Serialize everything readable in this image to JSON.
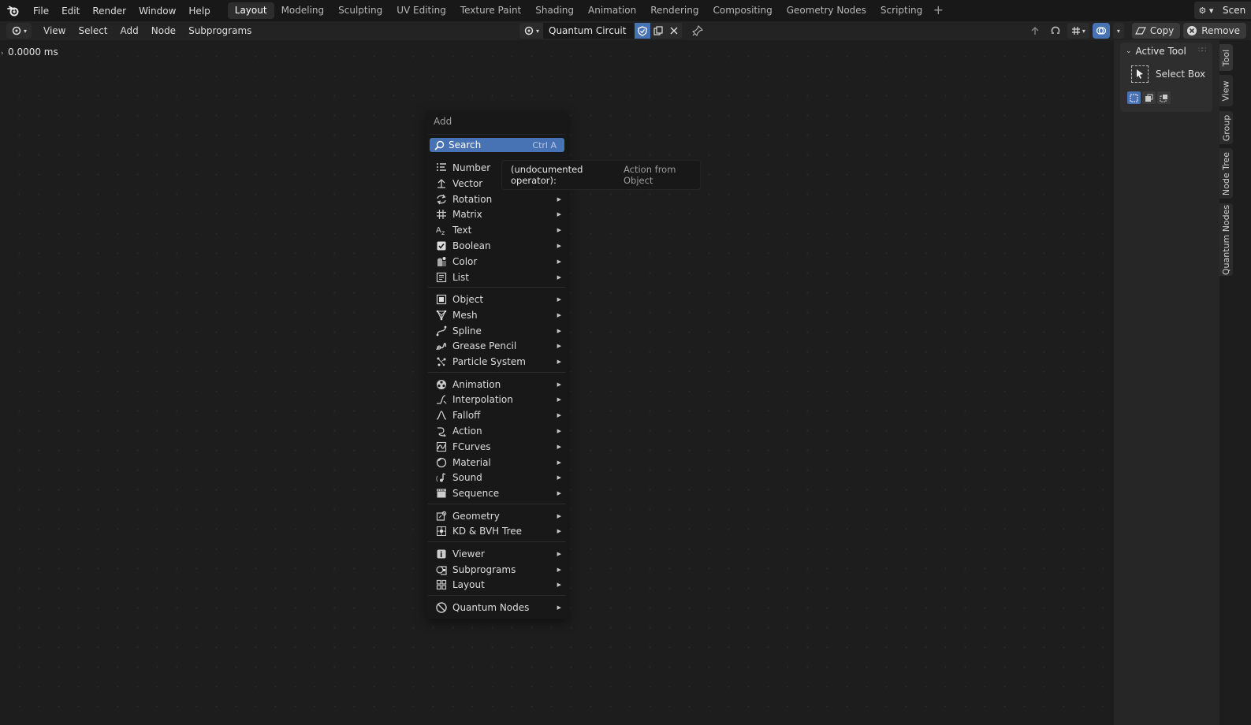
{
  "topbar": {
    "menus": [
      "File",
      "Edit",
      "Render",
      "Window",
      "Help"
    ],
    "workspaces": [
      "Layout",
      "Modeling",
      "Sculpting",
      "UV Editing",
      "Texture Paint",
      "Shading",
      "Animation",
      "Rendering",
      "Compositing",
      "Geometry Nodes",
      "Scripting"
    ],
    "active_workspace": "Layout",
    "add_workspace": "+",
    "scene_label": "Scen"
  },
  "header": {
    "menus": [
      "View",
      "Select",
      "Add",
      "Node",
      "Subprograms"
    ],
    "node_tree_name": "Quantum Circuit",
    "copy_label": "Copy",
    "remove_label": "Remove"
  },
  "canvas": {
    "timing": "0.0000 ms"
  },
  "sidebar": {
    "panel_title": "Active Tool",
    "tool_name": "Select Box",
    "tabs": [
      "Tool",
      "View",
      "Group",
      "Node Tree",
      "Quantum Nodes"
    ]
  },
  "add_menu": {
    "title": "Add",
    "search_label": "Search",
    "search_shortcut": "Ctrl A",
    "groups": [
      [
        {
          "label": "Number",
          "icon": "number-icon",
          "submenu": false
        },
        {
          "label": "Vector",
          "icon": "vector-icon",
          "submenu": false
        },
        {
          "label": "Rotation",
          "icon": "rotation-icon",
          "submenu": true
        },
        {
          "label": "Matrix",
          "icon": "matrix-icon",
          "submenu": true
        },
        {
          "label": "Text",
          "icon": "text-icon",
          "submenu": true
        },
        {
          "label": "Boolean",
          "icon": "checkbox-icon",
          "submenu": true
        },
        {
          "label": "Color",
          "icon": "color-icon",
          "submenu": true
        },
        {
          "label": "List",
          "icon": "list-icon",
          "submenu": true
        }
      ],
      [
        {
          "label": "Object",
          "icon": "object-icon",
          "submenu": true
        },
        {
          "label": "Mesh",
          "icon": "mesh-icon",
          "submenu": true
        },
        {
          "label": "Spline",
          "icon": "spline-icon",
          "submenu": true
        },
        {
          "label": "Grease Pencil",
          "icon": "grease-pencil-icon",
          "submenu": true
        },
        {
          "label": "Particle System",
          "icon": "particle-icon",
          "submenu": true
        }
      ],
      [
        {
          "label": "Animation",
          "icon": "animation-icon",
          "submenu": true
        },
        {
          "label": "Interpolation",
          "icon": "interpolation-icon",
          "submenu": true
        },
        {
          "label": "Falloff",
          "icon": "falloff-icon",
          "submenu": true
        },
        {
          "label": "Action",
          "icon": "action-icon",
          "submenu": true
        },
        {
          "label": "FCurves",
          "icon": "fcurve-icon",
          "submenu": true
        },
        {
          "label": "Material",
          "icon": "material-icon",
          "submenu": true
        },
        {
          "label": "Sound",
          "icon": "sound-icon",
          "submenu": true
        },
        {
          "label": "Sequence",
          "icon": "sequence-icon",
          "submenu": true
        }
      ],
      [
        {
          "label": "Geometry",
          "icon": "geometry-icon",
          "submenu": true
        },
        {
          "label": "KD & BVH Tree",
          "icon": "kdtree-icon",
          "submenu": true
        }
      ],
      [
        {
          "label": "Viewer",
          "icon": "viewer-icon",
          "submenu": true
        },
        {
          "label": "Subprograms",
          "icon": "subprograms-icon",
          "submenu": true
        },
        {
          "label": "Layout",
          "icon": "layout-icon",
          "submenu": true
        }
      ],
      [
        {
          "label": "Quantum Nodes",
          "icon": "quantum-icon",
          "submenu": true
        }
      ]
    ]
  },
  "tooltip": {
    "prefix": "(undocumented operator):",
    "text": "Action from Object"
  },
  "colors": {
    "accent": "#4772b3",
    "menu_bg": "#181818",
    "canvas_bg": "#1d1d1d"
  }
}
